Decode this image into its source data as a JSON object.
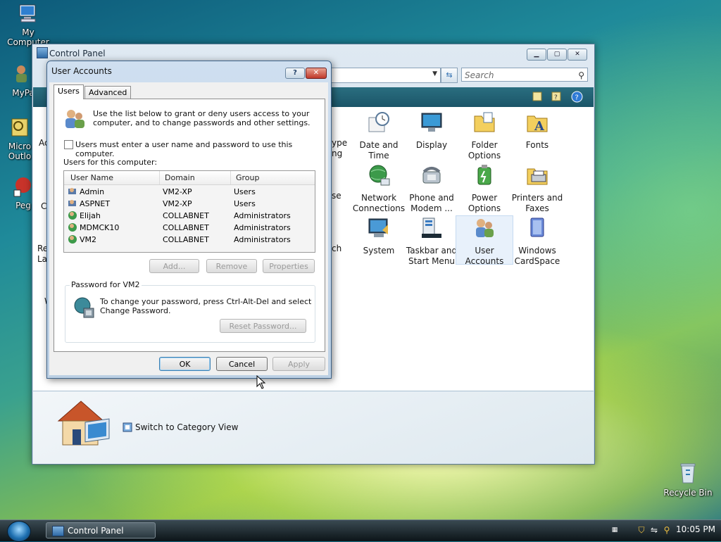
{
  "desktop": {
    "icons": [
      {
        "label": "My Computer"
      },
      {
        "label": "MyPa"
      },
      {
        "label": "Micro"
      },
      {
        "label": "Outlo"
      },
      {
        "label": "Peg"
      },
      {
        "label": "Recycle Bin"
      }
    ]
  },
  "control_panel": {
    "title": "Control Panel",
    "search_placeholder": "Search",
    "partial_labels": [
      "Ac",
      "C",
      "Re",
      "La",
      "W",
      "ype",
      "ng",
      "se",
      "ch"
    ],
    "items": [
      {
        "line1": "Date and",
        "line2": "Time"
      },
      {
        "line1": "Display",
        "line2": ""
      },
      {
        "line1": "Folder",
        "line2": "Options"
      },
      {
        "line1": "Fonts",
        "line2": ""
      },
      {
        "line1": "Network",
        "line2": "Connections"
      },
      {
        "line1": "Phone and",
        "line2": "Modem ..."
      },
      {
        "line1": "Power",
        "line2": "Options"
      },
      {
        "line1": "Printers and",
        "line2": "Faxes"
      },
      {
        "line1": "System",
        "line2": ""
      },
      {
        "line1": "Taskbar and",
        "line2": "Start Menu"
      },
      {
        "line1": "User",
        "line2": "Accounts"
      },
      {
        "line1": "Windows",
        "line2": "CardSpace"
      }
    ],
    "switch_view_label": "Switch to Category View"
  },
  "dialog": {
    "title": "User Accounts",
    "help_label": "?",
    "close_label": "✕",
    "tabs": [
      "Users",
      "Advanced"
    ],
    "intro_line1": "Use the list below to grant or deny users access to your",
    "intro_line2": "computer, and to change passwords and other settings.",
    "must_enter_label": "Users must enter a user name and password to use this computer.",
    "users_label": "Users for this computer:",
    "columns": [
      "User Name",
      "Domain",
      "Group"
    ],
    "users": [
      {
        "name": "Admin",
        "domain": "VM2-XP",
        "group": "Users"
      },
      {
        "name": "ASPNET",
        "domain": "VM2-XP",
        "group": "Users"
      },
      {
        "name": "Elijah",
        "domain": "COLLABNET",
        "group": "Administrators"
      },
      {
        "name": "MDMCK10",
        "domain": "COLLABNET",
        "group": "Administrators"
      },
      {
        "name": "VM2",
        "domain": "COLLABNET",
        "group": "Administrators"
      }
    ],
    "add_label": "Add...",
    "remove_label": "Remove",
    "properties_label": "Properties",
    "password_group_label": "Password for VM2",
    "password_line1": "To change your password, press Ctrl-Alt-Del and select",
    "password_line2": "Change Password.",
    "reset_label": "Reset Password...",
    "ok_label": "OK",
    "cancel_label": "Cancel",
    "apply_label": "Apply"
  },
  "taskbar": {
    "task_label": "Control Panel",
    "clock": "10:05 PM"
  }
}
